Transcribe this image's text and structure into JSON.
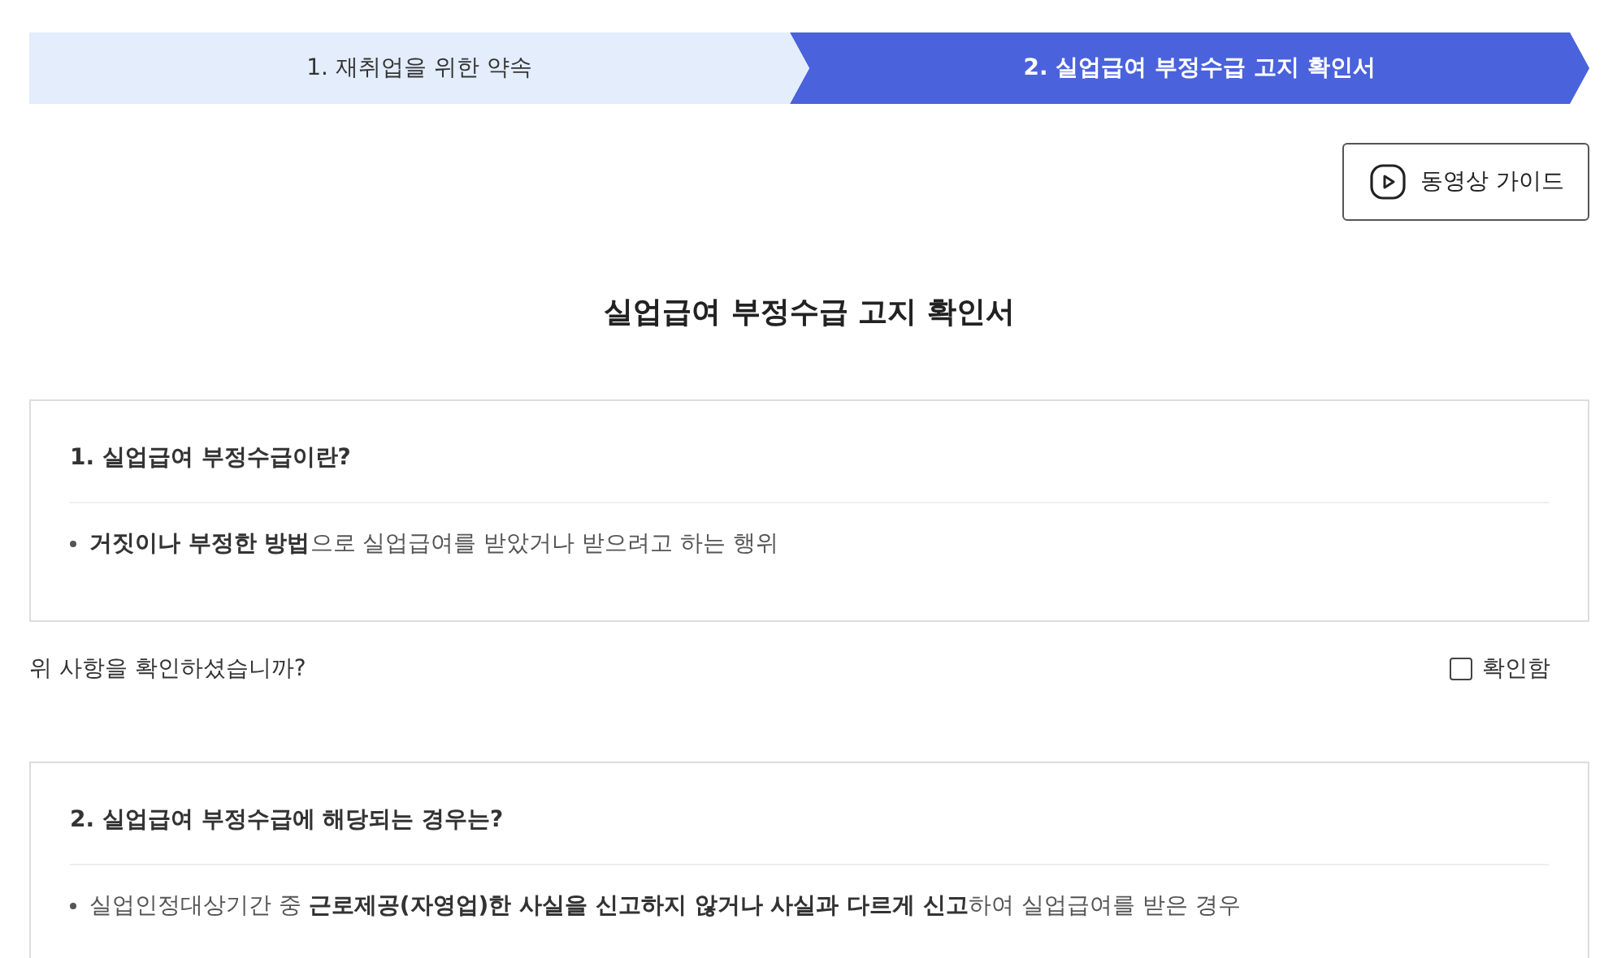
{
  "steps": [
    {
      "label": "1. 재취업을 위한 약속",
      "selected": false
    },
    {
      "label": "2. 실업급여 부정수급 고지 확인서",
      "selected": true
    }
  ],
  "video_button": {
    "label": "동영상 가이드"
  },
  "page_title": "실업급여 부정수급 고지 확인서",
  "sections": [
    {
      "heading": "1. 실업급여 부정수급이란?",
      "bullets": [
        "**거짓이나 부정한 방법**으로 실업급여를 받았거나 받으려고 하는 행위"
      ],
      "confirm": {
        "question": "위 사항을 확인하셨습니까?",
        "label": "확인함",
        "checked": false
      }
    },
    {
      "heading": "2. 실업급여 부정수급에 해당되는 경우는?",
      "bullets": [
        "실업인정대상기간 중 **근로제공(자영업)한 사실을 신고하지 않거나 사실과 다르게 신고**하여 실업급여를 받은 경우"
      ]
    }
  ]
}
